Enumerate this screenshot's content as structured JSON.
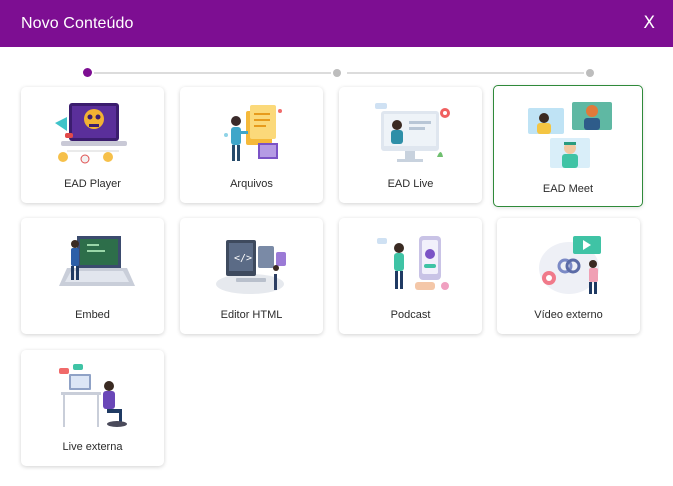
{
  "header": {
    "title": "Novo Conteúdo",
    "close_label": "X"
  },
  "colors": {
    "header_bg": "#7d0e92",
    "step_active": "#7d0e92",
    "selected_border": "#2f8a3a"
  },
  "stepper": {
    "steps": 3,
    "active_step": 1
  },
  "cards": [
    {
      "label": "EAD Player",
      "icon": "ead-player-illustration",
      "selected": false
    },
    {
      "label": "Arquivos",
      "icon": "files-illustration",
      "selected": false
    },
    {
      "label": "EAD Live",
      "icon": "live-illustration",
      "selected": false
    },
    {
      "label": "EAD Meet",
      "icon": "meet-illustration",
      "selected": true
    },
    {
      "label": "Embed",
      "icon": "embed-illustration",
      "selected": false
    },
    {
      "label": "Editor HTML",
      "icon": "html-editor-illustration",
      "selected": false
    },
    {
      "label": "Podcast",
      "icon": "podcast-illustration",
      "selected": false
    },
    {
      "label": "Vídeo externo",
      "icon": "external-video-illustration",
      "selected": false
    },
    {
      "label": "Live externa",
      "icon": "external-live-illustration",
      "selected": false
    }
  ]
}
